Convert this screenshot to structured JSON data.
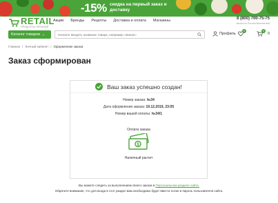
{
  "promo": {
    "discount": "-15%",
    "text": "скидка на первый заказ и доставку"
  },
  "header": {
    "logo": "RETAIL",
    "logo_sub": "ПРОДУКТЫ ПИТАНИЯ",
    "nav": [
      "Акции",
      "Бренды",
      "Рецепты",
      "Доставка и оплата",
      "Магазины"
    ],
    "phone": "8 (800) 700-75-75",
    "phone_sub": "звонок по России бесплатный",
    "catalog_label": "Каталог товаров",
    "search_placeholder": "Начните вводить название товара, например «Банан»",
    "profile_label": "Профиль",
    "favorites_count": "0",
    "cart_badge": "0",
    "cart_count": "0"
  },
  "breadcrumb": [
    "Главная",
    "Личный кабинет",
    "Оформление заказа"
  ],
  "page_title": "Заказ сформирован",
  "order": {
    "success_title": "Ваш заказ успешно создан!",
    "number_label": "Номер заказа:",
    "number_value": "№34",
    "date_label": "Дата оформления заказа:",
    "date_value": "19.12.2019, 23:05",
    "payment_number_label": "Номер вашей оплаты:",
    "payment_number_value": "№34/1",
    "payment_label": "Оплата заказа",
    "payment_method": "Наличный расчет"
  },
  "footer": {
    "line1_prefix": "Вы можете следить за выполнением своего заказа в",
    "line1_link": "Персональном разделе сайта.",
    "line2": "Обратите внимание, что для входа в этот раздел вам необходимо будет ввести логин и пароль пользователя сайта."
  },
  "colors": {
    "accent": "#4aa43a"
  }
}
